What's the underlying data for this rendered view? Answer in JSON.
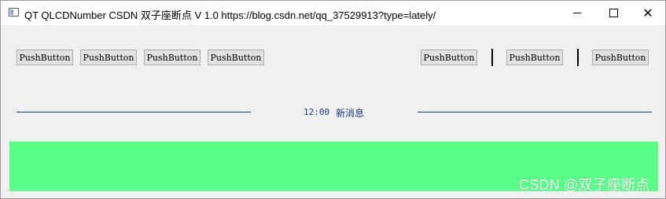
{
  "window": {
    "title": "QT QLCDNumber  CSDN 双子座断点 V 1.0 https://blog.csdn.net/qq_37529913?type=lately/",
    "minimize_label": "",
    "maximize_label": "",
    "close_label": "✕"
  },
  "toolbar": {
    "left_buttons": [
      "PushButton",
      "PushButton",
      "PushButton",
      "PushButton"
    ],
    "right_buttons": [
      "PushButton",
      "PushButton",
      "PushButton"
    ]
  },
  "status": {
    "clock": "12:00",
    "message": "新消息"
  },
  "colors": {
    "panel": "#58ff86",
    "line": "#1e3c78",
    "status_text": "#1a3a8a"
  },
  "watermark": "CSDN @双子座断点"
}
